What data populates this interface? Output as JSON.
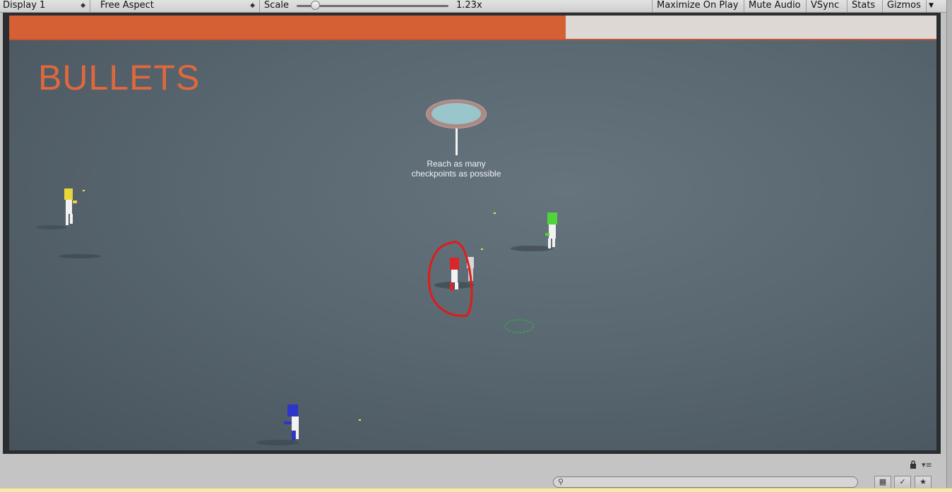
{
  "toolbar": {
    "display_label": "Display 1",
    "aspect_label": "Free Aspect",
    "scale_label": "Scale",
    "scale_value": "1.23x",
    "scale_fraction": 0.06,
    "buttons": [
      "Maximize On Play",
      "Mute Audio",
      "VSync",
      "Stats",
      "Gizmos"
    ],
    "dropdown_icon": "updown-arrow-icon",
    "gizmos_icon": "chevron-down-icon"
  },
  "game": {
    "title": "BULLETS",
    "progress_fraction": 0.6,
    "progress_color": "#d46033",
    "hint_lines": [
      "Reach as many",
      "checkpoints as possible"
    ],
    "players": [
      {
        "name": "yellow-player",
        "color": "#e8d63a"
      },
      {
        "name": "green-player",
        "color": "#4fd43a"
      },
      {
        "name": "red-player",
        "color": "#d9262a",
        "highlighted": true
      },
      {
        "name": "blue-player",
        "color": "#2d36c9"
      }
    ]
  },
  "bottom": {
    "lock_icon": "lock-icon",
    "menu_icon": "menu-icon",
    "search_icon": "search-icon",
    "tool_icons": [
      "layers-icon",
      "tag-icon",
      "star-icon"
    ]
  }
}
